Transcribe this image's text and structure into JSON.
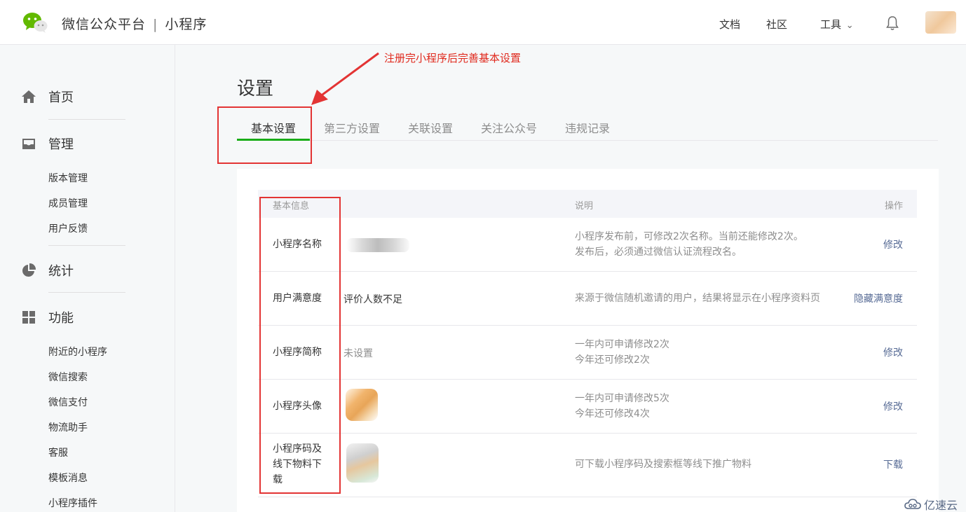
{
  "header": {
    "brand": "微信公众平台",
    "separator": "|",
    "product": "小程序",
    "nav": [
      "文档",
      "社区",
      "工具"
    ],
    "tools_caret": "⌄"
  },
  "sidebar": {
    "sections": [
      {
        "label": "首页",
        "icon": "home-icon"
      },
      {
        "label": "管理",
        "icon": "inbox-icon",
        "items": [
          "版本管理",
          "成员管理",
          "用户反馈"
        ]
      },
      {
        "label": "统计",
        "icon": "pie-chart-icon"
      },
      {
        "label": "功能",
        "icon": "grid-icon",
        "items": [
          "附近的小程序",
          "微信搜索",
          "微信支付",
          "物流助手",
          "客服",
          "模板消息",
          "小程序插件"
        ]
      }
    ]
  },
  "main": {
    "title": "设置",
    "tabs": [
      "基本设置",
      "第三方设置",
      "关联设置",
      "关注公众号",
      "违规记录"
    ],
    "active_tab": 0,
    "table": {
      "headers": [
        "基本信息",
        "说明",
        "操作"
      ],
      "rows": [
        {
          "label": "小程序名称",
          "value": "",
          "desc1": "小程序发布前，可修改2次名称。当前还能修改2次。",
          "desc2": "发布后，必须通过微信认证流程改名。",
          "action": "修改"
        },
        {
          "label": "用户满意度",
          "value": "评价人数不足",
          "desc1": "来源于微信随机邀请的用户，结果将显示在小程序资料页",
          "desc2": "",
          "action": "隐藏满意度"
        },
        {
          "label": "小程序简称",
          "value": "未设置",
          "desc1": "一年内可申请修改2次",
          "desc2": "今年还可修改2次",
          "action": "修改"
        },
        {
          "label": "小程序头像",
          "value": "",
          "desc1": "一年内可申请修改5次",
          "desc2": "今年还可修改4次",
          "action": "修改"
        },
        {
          "label_lines": [
            "小程序码及",
            "线下物料下",
            "载"
          ],
          "value": "",
          "desc1": "可下载小程序码及搜索框等线下推广物料",
          "desc2": "",
          "action": "下载"
        }
      ]
    }
  },
  "annotation": {
    "text": "注册完小程序后完善基本设置",
    "color": "#e33434"
  },
  "watermark": "亿速云",
  "colors": {
    "accent_green": "#1aad19",
    "link": "#576b95",
    "annotation_red": "#e33434"
  }
}
